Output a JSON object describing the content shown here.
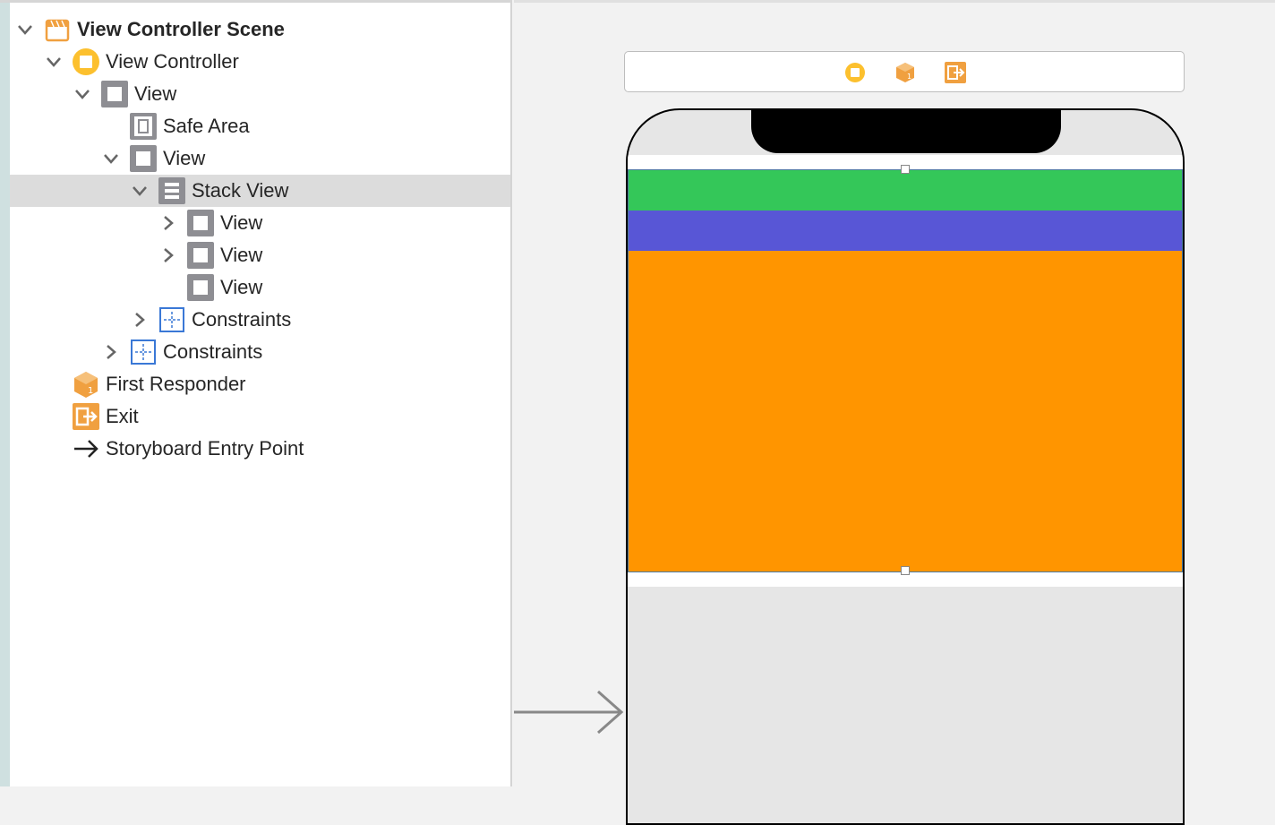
{
  "outline": {
    "items": [
      {
        "label": "View Controller Scene",
        "icon": "scene-icon",
        "disclosure": "expanded",
        "bold": true
      },
      {
        "label": "View Controller",
        "icon": "view-controller-icon",
        "disclosure": "expanded"
      },
      {
        "label": "View",
        "icon": "view-icon",
        "disclosure": "expanded"
      },
      {
        "label": "Safe Area",
        "icon": "safe-area-icon",
        "disclosure": "none"
      },
      {
        "label": "View",
        "icon": "view-icon",
        "disclosure": "expanded"
      },
      {
        "label": "Stack View",
        "icon": "stack-view-icon",
        "disclosure": "expanded",
        "selected": true
      },
      {
        "label": "View",
        "icon": "view-icon",
        "disclosure": "collapsed"
      },
      {
        "label": "View",
        "icon": "view-icon",
        "disclosure": "collapsed"
      },
      {
        "label": "View",
        "icon": "view-icon",
        "disclosure": "none"
      },
      {
        "label": "Constraints",
        "icon": "constraints-icon",
        "disclosure": "collapsed"
      },
      {
        "label": "Constraints",
        "icon": "constraints-icon",
        "disclosure": "collapsed"
      },
      {
        "label": "First Responder",
        "icon": "first-responder-icon",
        "disclosure": "none"
      },
      {
        "label": "Exit",
        "icon": "exit-icon",
        "disclosure": "none"
      },
      {
        "label": "Storyboard Entry Point",
        "icon": "entry-arrow-icon",
        "disclosure": "none"
      }
    ]
  },
  "canvas": {
    "dock_icons": [
      "view-controller-icon",
      "first-responder-icon",
      "exit-icon"
    ],
    "stack_colors": [
      "#34c759",
      "#5856d6",
      "#ff9500"
    ]
  },
  "colors": {
    "selection": "#dcdcdc",
    "accent_orange": "#ff9500",
    "icon_orange": "#f0a040",
    "icon_yellow": "#fcc02e",
    "icon_blue": "#3a78d6"
  }
}
